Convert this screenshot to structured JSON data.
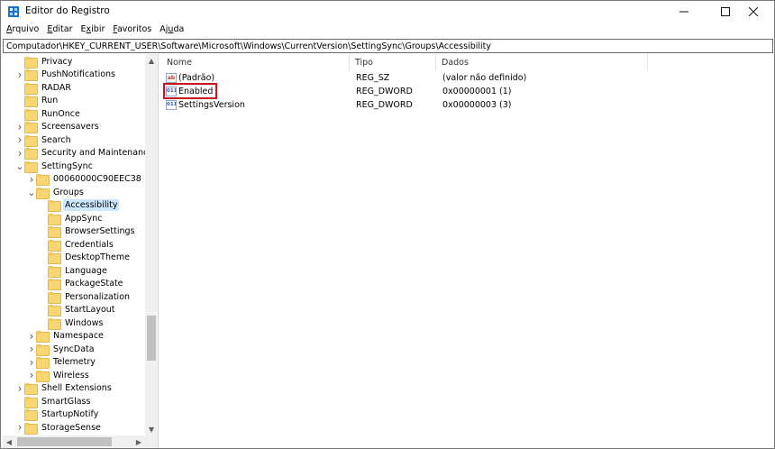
{
  "window": {
    "title": "Editor do Registro",
    "minimize": "minimize",
    "maximize": "maximize",
    "close": "close"
  },
  "menu": [
    "Arquivo",
    "Editar",
    "Exibir",
    "Favoritos",
    "Ajuda"
  ],
  "address": "Computador\\HKEY_CURRENT_USER\\Software\\Microsoft\\Windows\\CurrentVersion\\SettingSync\\Groups\\Accessibility",
  "tree": {
    "items": [
      {
        "label": "Privacy",
        "depth": 0,
        "expander": "none"
      },
      {
        "label": "PushNotifications",
        "depth": 0,
        "expander": "collapsed"
      },
      {
        "label": "RADAR",
        "depth": 0,
        "expander": "none"
      },
      {
        "label": "Run",
        "depth": 0,
        "expander": "none"
      },
      {
        "label": "RunOnce",
        "depth": 0,
        "expander": "none"
      },
      {
        "label": "Screensavers",
        "depth": 0,
        "expander": "collapsed"
      },
      {
        "label": "Search",
        "depth": 0,
        "expander": "collapsed"
      },
      {
        "label": "Security and Maintenance",
        "depth": 0,
        "expander": "collapsed"
      },
      {
        "label": "SettingSync",
        "depth": 0,
        "expander": "expanded"
      },
      {
        "label": "00060000C90EEC38",
        "depth": 1,
        "expander": "collapsed"
      },
      {
        "label": "Groups",
        "depth": 1,
        "expander": "expanded"
      },
      {
        "label": "Accessibility",
        "depth": 2,
        "expander": "none",
        "selected": true
      },
      {
        "label": "AppSync",
        "depth": 2,
        "expander": "none"
      },
      {
        "label": "BrowserSettings",
        "depth": 2,
        "expander": "none"
      },
      {
        "label": "Credentials",
        "depth": 2,
        "expander": "none"
      },
      {
        "label": "DesktopTheme",
        "depth": 2,
        "expander": "none"
      },
      {
        "label": "Language",
        "depth": 2,
        "expander": "none"
      },
      {
        "label": "PackageState",
        "depth": 2,
        "expander": "none"
      },
      {
        "label": "Personalization",
        "depth": 2,
        "expander": "none"
      },
      {
        "label": "StartLayout",
        "depth": 2,
        "expander": "none"
      },
      {
        "label": "Windows",
        "depth": 2,
        "expander": "none"
      },
      {
        "label": "Namespace",
        "depth": 1,
        "expander": "collapsed"
      },
      {
        "label": "SyncData",
        "depth": 1,
        "expander": "collapsed"
      },
      {
        "label": "Telemetry",
        "depth": 1,
        "expander": "collapsed"
      },
      {
        "label": "Wireless",
        "depth": 1,
        "expander": "collapsed"
      },
      {
        "label": "Shell Extensions",
        "depth": 0,
        "expander": "collapsed"
      },
      {
        "label": "SmartGlass",
        "depth": 0,
        "expander": "none"
      },
      {
        "label": "StartupNotify",
        "depth": 0,
        "expander": "none"
      },
      {
        "label": "StorageSense",
        "depth": 0,
        "expander": "collapsed"
      }
    ]
  },
  "list": {
    "columns": [
      "Nome",
      "Tipo",
      "Dados"
    ],
    "rows": [
      {
        "name": "(Padrão)",
        "type": "REG_SZ",
        "data": "(valor não definido)",
        "icon": "string-value-icon",
        "glyph": "ab"
      },
      {
        "name": "Enabled",
        "type": "REG_DWORD",
        "data": "0x00000001 (1)",
        "icon": "dword-value-icon",
        "glyph": "011",
        "highlighted": true
      },
      {
        "name": "SettingsVersion",
        "type": "REG_DWORD",
        "data": "0x00000003 (3)",
        "icon": "dword-value-icon",
        "glyph": "011"
      }
    ]
  },
  "colors": {
    "selection": "#cce8ff",
    "highlight_box": "#c4161c",
    "folder": "#f7d674"
  }
}
